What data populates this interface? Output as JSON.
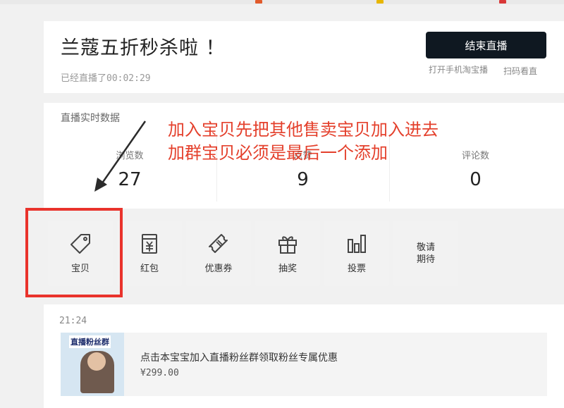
{
  "header": {
    "title": "兰蔻五折秒杀啦 ！",
    "duration": "已经直播了00:02:29",
    "end_button": "结束直播",
    "open_mobile_taobao": "打开手机淘宝播",
    "scan_to_watch": "扫码看直"
  },
  "stats": {
    "title": "直播实时数据",
    "items": [
      {
        "label": "浏览数",
        "value": "27"
      },
      {
        "label": "点赞",
        "value": "9"
      },
      {
        "label": "评论数",
        "value": "0"
      }
    ]
  },
  "annotation": {
    "line1": "加入宝贝先把其他售卖宝贝加入进去",
    "line2": "加群宝贝必须是最后一个添加"
  },
  "tools": {
    "items": [
      {
        "label": "宝贝",
        "icon": "tag-icon"
      },
      {
        "label": "红包",
        "icon": "red-envelope-icon"
      },
      {
        "label": "优惠券",
        "icon": "coupon-icon"
      },
      {
        "label": "抽奖",
        "icon": "gift-icon"
      },
      {
        "label": "投票",
        "icon": "bar-chart-icon"
      }
    ],
    "coming_soon": "敬请期待"
  },
  "feed": {
    "time": "21:24",
    "item": {
      "thumb_badge": "直播粉丝群",
      "text": "点击本宝宝加入直播粉丝群领取粉丝专属优惠",
      "price": "¥299.00"
    }
  },
  "colors": {
    "accent_red": "#e9332c",
    "button_dark": "#0f1821"
  }
}
